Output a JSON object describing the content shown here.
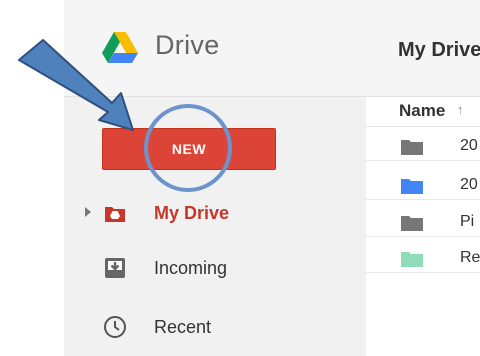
{
  "header": {
    "app_name": "Drive",
    "breadcrumb": "My Drive"
  },
  "sidebar": {
    "new_button": "NEW",
    "items": [
      {
        "label": "My Drive",
        "icon": "my-drive-icon",
        "active": true
      },
      {
        "label": "Incoming",
        "icon": "incoming-icon"
      },
      {
        "label": "Recent",
        "icon": "clock-icon"
      }
    ]
  },
  "file_list": {
    "column_name": "Name",
    "sort_indicator": "↑",
    "rows": [
      {
        "name": "20",
        "folder_color": "#777777"
      },
      {
        "name": "20",
        "folder_color": "#4285f4"
      },
      {
        "name": "Pi",
        "folder_color": "#777777"
      },
      {
        "name": "Re",
        "folder_color": "#8fdcb8"
      }
    ]
  },
  "colors": {
    "accent_red": "#db4437",
    "annotation_blue": "#4f81bd"
  }
}
